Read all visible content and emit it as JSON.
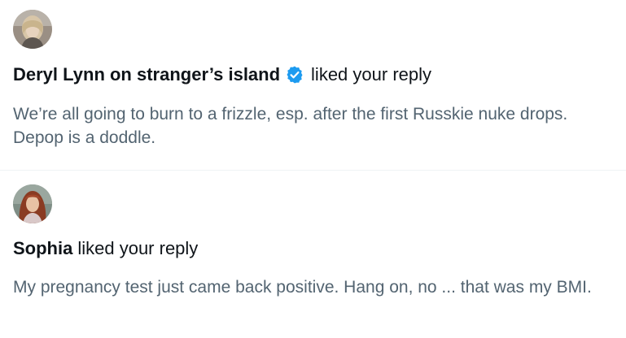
{
  "notifications": [
    {
      "user": "Deryl Lynn on stranger’s island",
      "verified": true,
      "action": "liked your reply",
      "text": "We’re all going to burn to a frizzle, esp. after the first Russkie nuke drops. Depop is a doddle.",
      "avatar_icon": "avatar-photo-woman-light-hair"
    },
    {
      "user": "Sophia",
      "verified": false,
      "action": "liked your reply",
      "text": "My pregnancy test just came back positive. Hang on, no ... that was my BMI.",
      "avatar_icon": "avatar-photo-woman-red-hair"
    }
  ],
  "colors": {
    "verified_badge": "#1d9bf0",
    "secondary_text": "#536471",
    "primary_text": "#0f1419",
    "divider": "#eff3f4"
  }
}
